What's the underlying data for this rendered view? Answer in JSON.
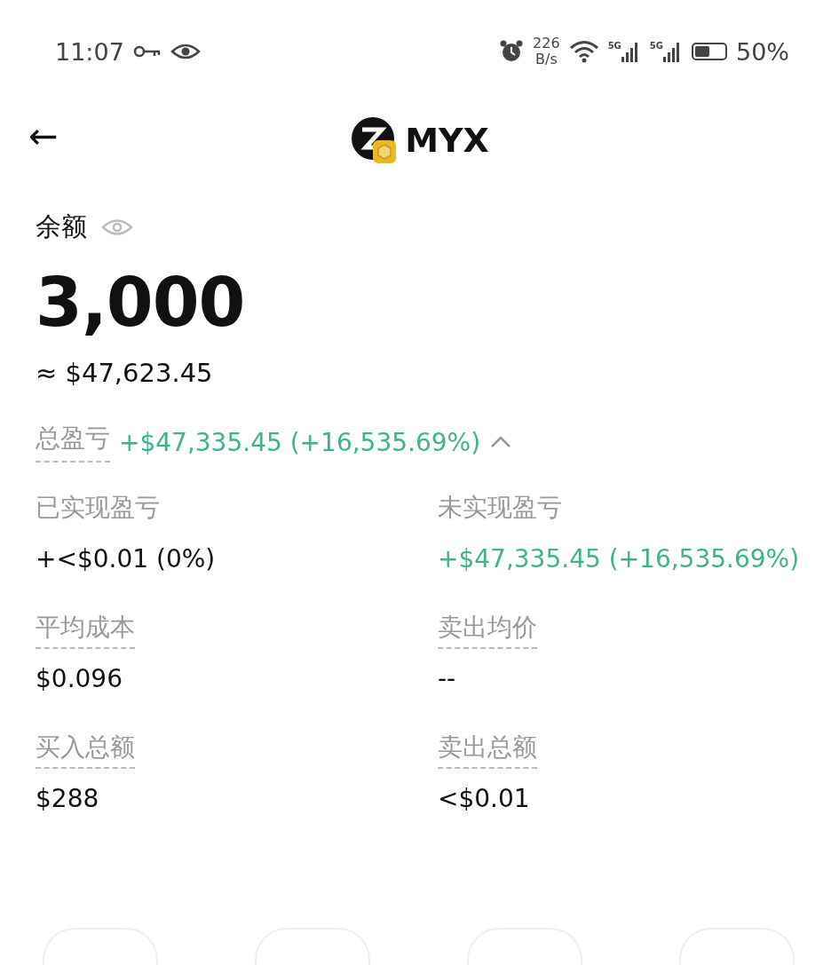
{
  "status_bar": {
    "time": "11:07",
    "net_speed": "226",
    "net_unit": "B/s",
    "signal_1": "5G",
    "signal_2": "5G",
    "battery": "50%"
  },
  "header": {
    "back": "←",
    "title": "MYX"
  },
  "balance": {
    "label": "余额",
    "amount": "3,000",
    "fiat": "≈ $47,623.45"
  },
  "total_pnl": {
    "label": "总盈亏",
    "value": "+$47,335.45 (+16,535.69%)",
    "expanded": true
  },
  "stats": [
    {
      "label": "已实现盈亏",
      "value": "+<$0.01 (0%)",
      "positive": false,
      "underlined": false
    },
    {
      "label": "未实现盈亏",
      "value": "+$47,335.45 (+16,535.69%)",
      "positive": true,
      "underlined": false
    },
    {
      "label": "平均成本",
      "value": "$0.096",
      "positive": false,
      "underlined": true
    },
    {
      "label": "卖出均价",
      "value": "--",
      "positive": false,
      "underlined": true
    },
    {
      "label": "买入总额",
      "value": "$288",
      "positive": false,
      "underlined": true
    },
    {
      "label": "卖出总额",
      "value": "<$0.01",
      "positive": false,
      "underlined": true
    }
  ],
  "actions": [
    {
      "kind": "button"
    },
    {
      "kind": "button"
    },
    {
      "kind": "button"
    },
    {
      "kind": "button"
    }
  ]
}
